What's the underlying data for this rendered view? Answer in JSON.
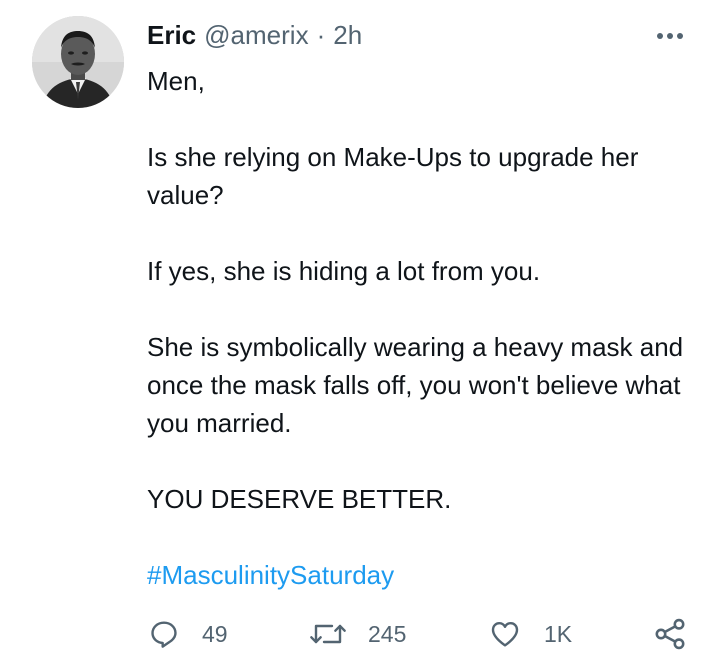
{
  "tweet": {
    "author_name": "Eric",
    "author_handle": "@amerix",
    "separator": "·",
    "timestamp": "2h",
    "paragraphs": [
      "Men,",
      "Is she relying on Make-Ups to upgrade her value?",
      "If yes, she is hiding a lot from you.",
      "She is symbolically wearing a heavy mask and once the mask falls off, you won't believe what you married.",
      "YOU DESERVE BETTER."
    ],
    "hashtag": "#MasculinitySaturday"
  },
  "actions": {
    "reply_count": "49",
    "retweet_count": "245",
    "like_count": "1K"
  },
  "icons": {
    "more": "more-horizontal-icon",
    "reply": "reply-icon",
    "retweet": "retweet-icon",
    "like": "heart-icon",
    "share": "share-icon"
  },
  "colors": {
    "text": "#0f1419",
    "secondary": "#536471",
    "link": "#1d9bf0"
  }
}
